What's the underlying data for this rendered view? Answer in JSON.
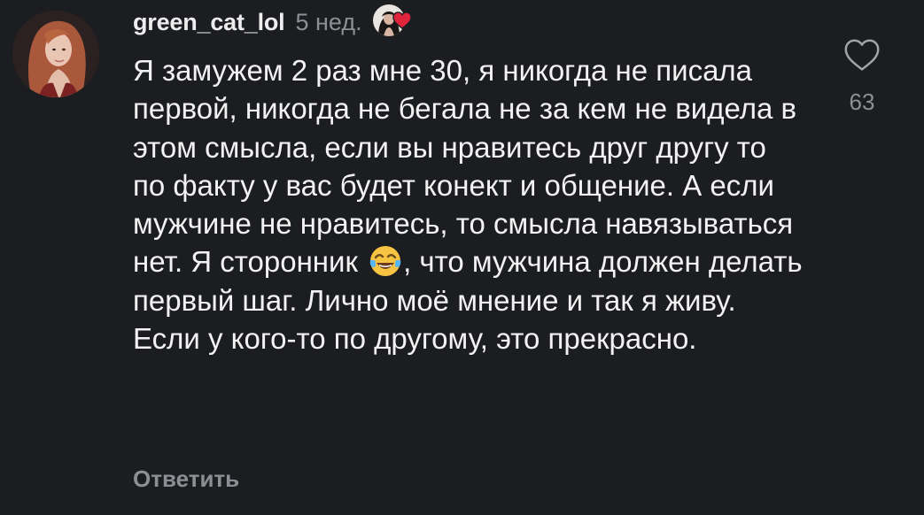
{
  "comment": {
    "username": "green_cat_lol",
    "time": "5 нед.",
    "text_before_emoji": "Я замужем 2 раз мне 30, я никогда не писала первой, никогда не бегала не за кем не видела в этом смысла, если вы нравитесь друг другу то по факту у вас будет конект и общение. А если мужчине не нравитесь, то смысла навязываться нет. Я сторонник ",
    "emoji": "😂",
    "text_after_emoji": ", что мужчина должен делать первый шаг. Лично моё мнение и так я живу. Если у кого-то по другому, это прекрасно.",
    "reply_label": "Ответить",
    "like_count": "63",
    "author_liked": true
  },
  "colors": {
    "background": "#1c1d21",
    "primary_text": "#f2f2f2",
    "secondary_text": "#8e8f94",
    "heart_red": "#e0243c"
  },
  "icons": {
    "like": "heart-outline-icon",
    "author_like": "heart-filled-icon"
  }
}
